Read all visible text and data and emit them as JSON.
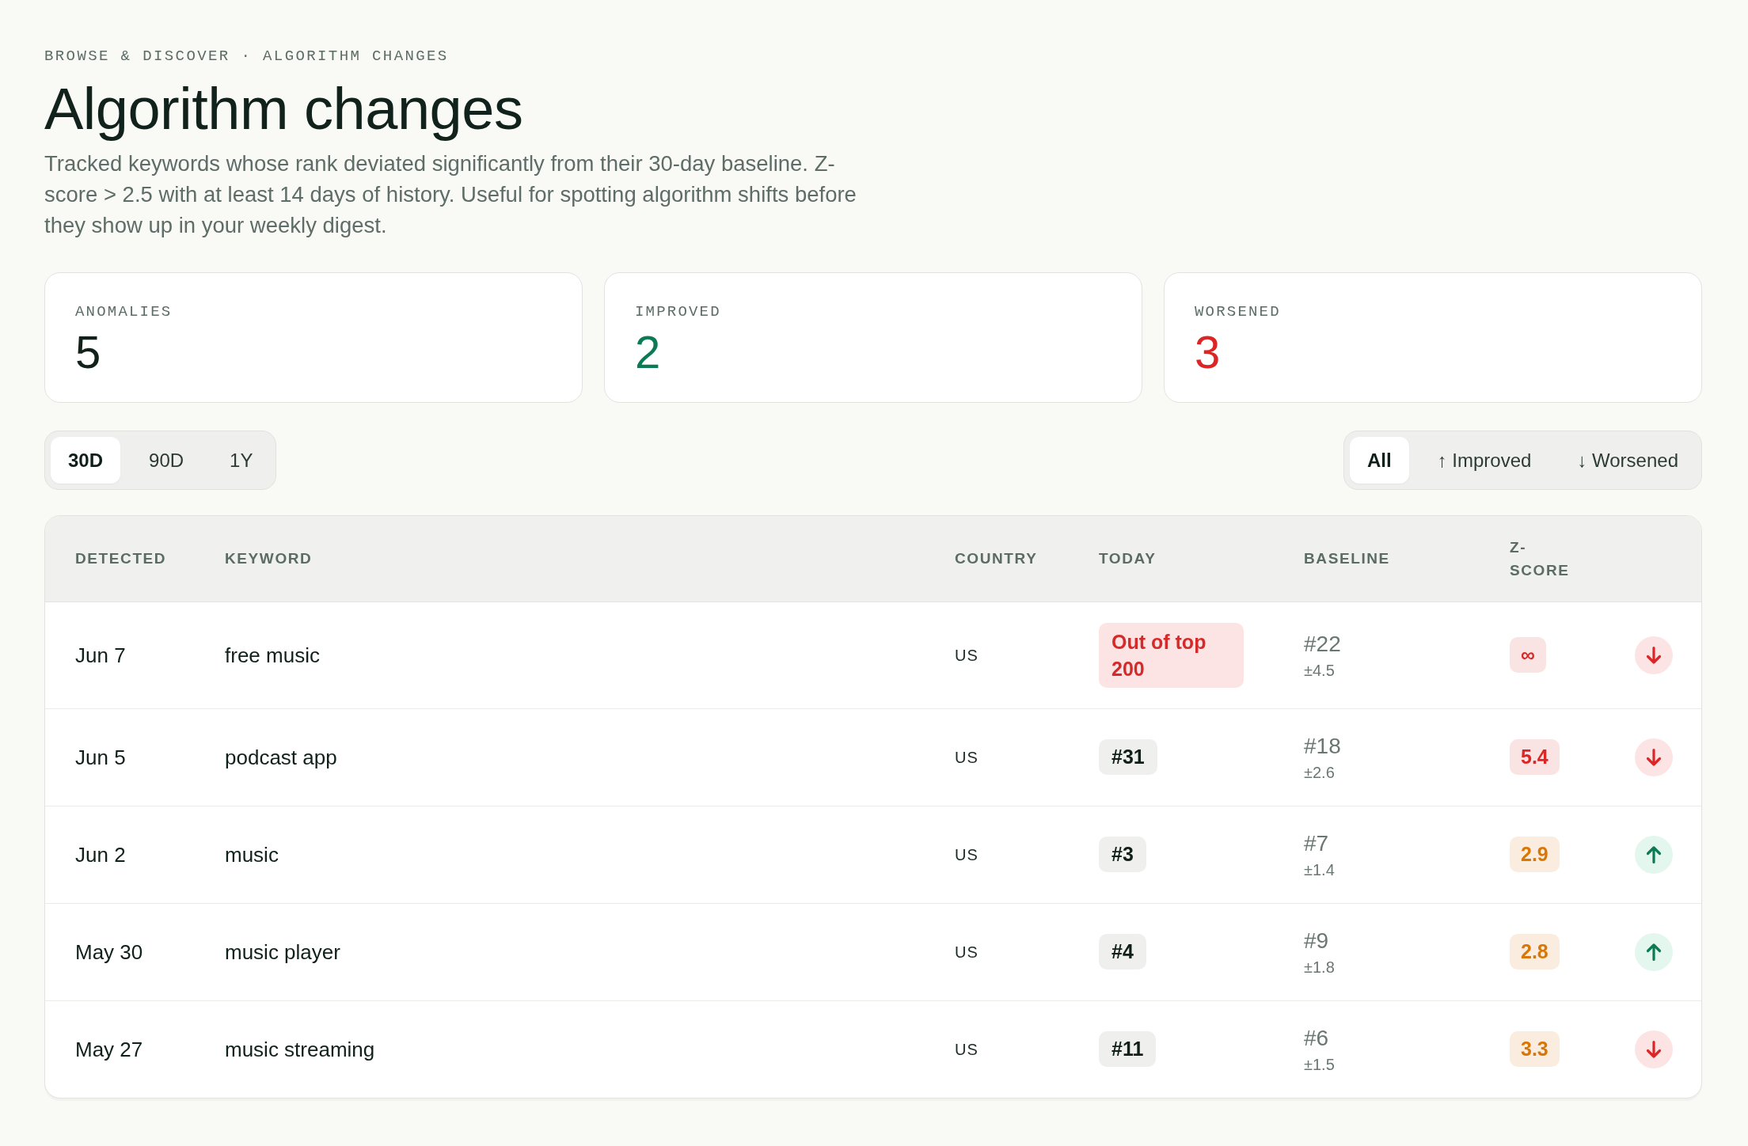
{
  "breadcrumb": "BROWSE & DISCOVER · ALGORITHM CHANGES",
  "title": "Algorithm changes",
  "description": "Tracked keywords whose rank deviated significantly from their 30-day baseline. Z-score > 2.5 with at least 14 days of history. Useful for spotting algorithm shifts before they show up in your weekly digest.",
  "stats": [
    {
      "label": "ANOMALIES",
      "value": "5",
      "color": "#12221b"
    },
    {
      "label": "IMPROVED",
      "value": "2",
      "color": "#0b7a55"
    },
    {
      "label": "WORSENED",
      "value": "3",
      "color": "#dc2626"
    }
  ],
  "range_tabs": [
    {
      "label": "30D",
      "selected": true
    },
    {
      "label": "90D",
      "selected": false
    },
    {
      "label": "1Y",
      "selected": false
    }
  ],
  "direction_filter": [
    {
      "label": "All",
      "selected": true
    },
    {
      "label": "↑ Improved",
      "selected": false
    },
    {
      "label": "↓ Worsened",
      "selected": false
    }
  ],
  "table": {
    "columns": [
      "DETECTED",
      "KEYWORD",
      "COUNTRY",
      "TODAY",
      "BASELINE",
      "Z-SCORE"
    ],
    "rows": [
      {
        "detected": "Jun 7",
        "keyword": "free music",
        "country": "US",
        "today": "Out of top 200",
        "today_alert": true,
        "baseline": "#22",
        "baseline_spread": "±4.5",
        "z_score": "∞",
        "color": "#dc2626",
        "improved": false
      },
      {
        "detected": "Jun 5",
        "keyword": "podcast app",
        "country": "US",
        "today": "#31",
        "today_alert": false,
        "baseline": "#18",
        "baseline_spread": "±2.6",
        "z_score": "5.4",
        "color": "#dc2626",
        "improved": false
      },
      {
        "detected": "Jun 2",
        "keyword": "music",
        "country": "US",
        "today": "#3",
        "today_alert": false,
        "baseline": "#7",
        "baseline_spread": "±1.4",
        "z_score": "2.9",
        "color": "#d97706",
        "improved": true
      },
      {
        "detected": "May 30",
        "keyword": "music player",
        "country": "US",
        "today": "#4",
        "today_alert": false,
        "baseline": "#9",
        "baseline_spread": "±1.8",
        "z_score": "2.8",
        "color": "#d97706",
        "improved": true
      },
      {
        "detected": "May 27",
        "keyword": "music streaming",
        "country": "US",
        "today": "#11",
        "today_alert": false,
        "baseline": "#6",
        "baseline_spread": "±1.5",
        "z_score": "3.3",
        "color": "#d97706",
        "improved": false
      }
    ]
  }
}
